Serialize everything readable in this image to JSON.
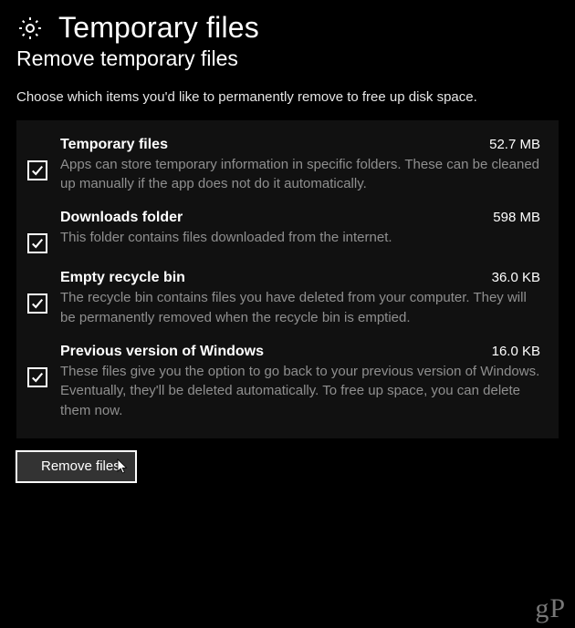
{
  "header": {
    "title": "Temporary files",
    "subtitle": "Remove temporary files",
    "intro": "Choose which items you'd like to permanently remove to free up disk space."
  },
  "items": [
    {
      "title": "Temporary files",
      "size": "52.7 MB",
      "description": "Apps can store temporary information in specific folders. These can be cleaned up manually if the app does not do it automatically."
    },
    {
      "title": "Downloads folder",
      "size": "598 MB",
      "description": "This folder contains files downloaded from the internet."
    },
    {
      "title": "Empty recycle bin",
      "size": "36.0 KB",
      "description": "The recycle bin contains files you have deleted from your computer. They will be permanently removed when the recycle bin is emptied."
    },
    {
      "title": "Previous version of Windows",
      "size": "16.0 KB",
      "description": "These files give you the option to go back to your previous version of Windows. Eventually, they'll be deleted automatically. To free up space, you can delete them now."
    }
  ],
  "actions": {
    "remove_label": "Remove files"
  },
  "watermark": {
    "g": "g",
    "p": "P"
  }
}
